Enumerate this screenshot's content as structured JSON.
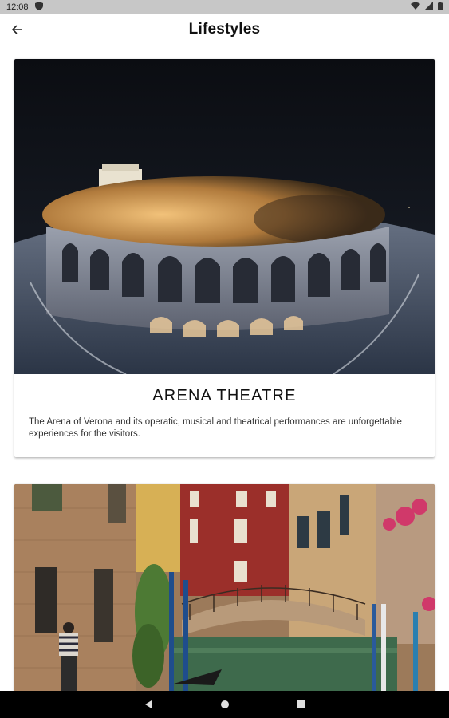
{
  "status_bar": {
    "time": "12:08",
    "icons": [
      "notification-shield-icon",
      "wifi-icon",
      "signal-icon",
      "battery-icon"
    ]
  },
  "app_bar": {
    "title": "Lifestyles",
    "back_icon": "arrow-back-icon"
  },
  "cards": [
    {
      "title": "ARENA THEATRE",
      "description": "The Arena of Verona and its operatic, musical and theatrical performances are unforgettable experiences for the visitors.",
      "image": "arena-photo"
    },
    {
      "title": "",
      "description": "",
      "image": "venice-canal-photo"
    }
  ],
  "nav_bar": {
    "icons": [
      "nav-back-icon",
      "nav-home-icon",
      "nav-recents-icon"
    ]
  },
  "colors": {
    "status_bar": "#c7c7c7",
    "nav_bar": "#000000",
    "background": "#ffffff"
  }
}
